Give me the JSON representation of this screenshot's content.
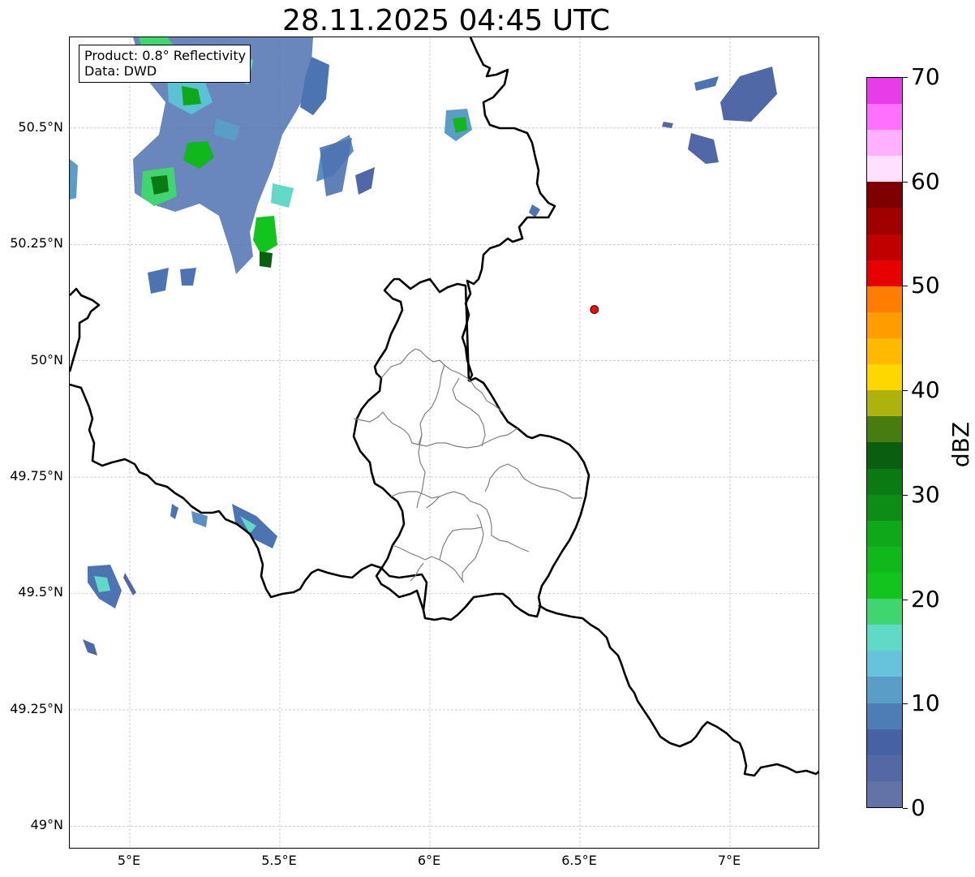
{
  "title": "28.11.2025 04:45 UTC",
  "info": {
    "product": "Product: 0.8° Reflectivity",
    "source": "Data: DWD"
  },
  "axes": {
    "lon_min": 4.8,
    "lon_max": 7.3,
    "lat_min": 48.95,
    "lat_max": 50.695,
    "x_ticks": [
      {
        "value": 5.0,
        "label": "5°E"
      },
      {
        "value": 5.5,
        "label": "5.5°E"
      },
      {
        "value": 6.0,
        "label": "6°E"
      },
      {
        "value": 6.5,
        "label": "6.5°E"
      },
      {
        "value": 7.0,
        "label": "7°E"
      }
    ],
    "y_ticks": [
      {
        "value": 50.5,
        "label": "50.5°N"
      },
      {
        "value": 50.25,
        "label": "50.25°N"
      },
      {
        "value": 50.0,
        "label": "50°N"
      },
      {
        "value": 49.75,
        "label": "49.75°N"
      },
      {
        "value": 49.5,
        "label": "49.5°N"
      },
      {
        "value": 49.25,
        "label": "49.25°N"
      },
      {
        "value": 49.0,
        "label": "49°N"
      }
    ],
    "grid": true
  },
  "radar_site": {
    "lon": 6.548,
    "lat": 50.11,
    "color": "#ff0000"
  },
  "colorbar": {
    "label": "dBZ",
    "min": 0,
    "max": 70,
    "step": 2.5,
    "ticks": [
      "0",
      "10",
      "20",
      "30",
      "40",
      "50",
      "60",
      "70"
    ],
    "colors": [
      "#6373a8",
      "#5568a6",
      "#4761a5",
      "#4e7db5",
      "#5a9ec8",
      "#67c2dc",
      "#61d9c7",
      "#3fd670",
      "#13c41e",
      "#10b81c",
      "#0fa81a",
      "#0d8c16",
      "#0b7a12",
      "#0a5e10",
      "#487b10",
      "#adb20c",
      "#ffd700",
      "#ffba00",
      "#ff9d00",
      "#ff7d00",
      "#e60000",
      "#c00000",
      "#a00000",
      "#7e0000",
      "#ffe0ff",
      "#ffb0ff",
      "#ff70ff",
      "#e83ce8"
    ]
  }
}
